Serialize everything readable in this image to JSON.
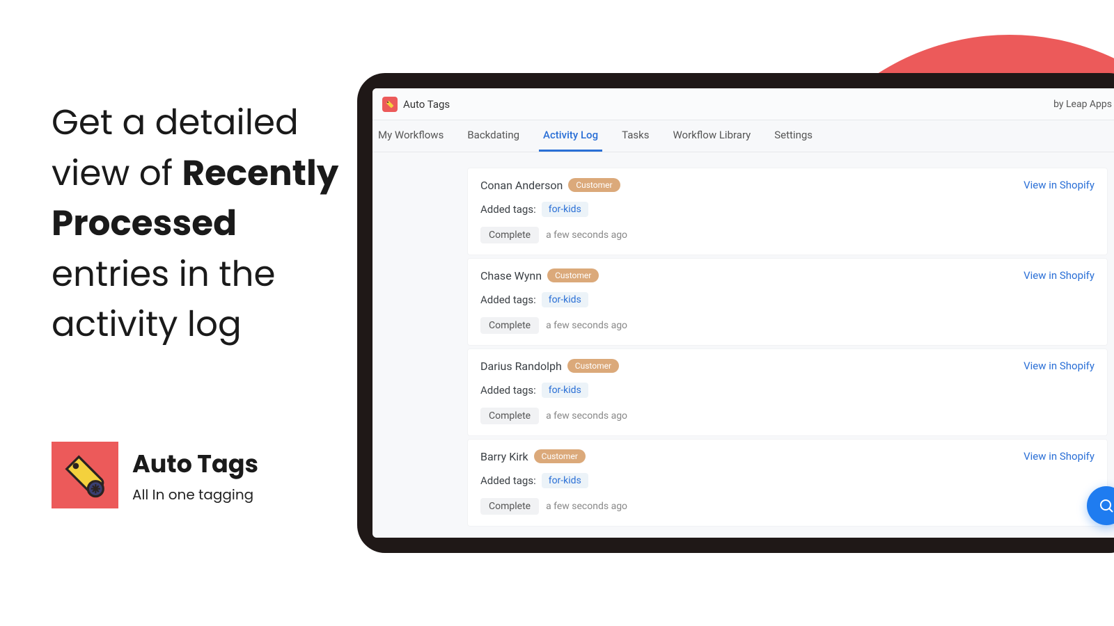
{
  "marketing": {
    "line1": "Get a detailed view of",
    "bold": "Recently Processed",
    "line2": "entries in the activity log"
  },
  "brand": {
    "name": "Auto Tags",
    "tagline": "All In one tagging"
  },
  "header": {
    "app_title": "Auto Tags",
    "by_text": "by Leap Apps"
  },
  "tabs": [
    {
      "label": "My Workflows",
      "active": false
    },
    {
      "label": "Backdating",
      "active": false
    },
    {
      "label": "Activity Log",
      "active": true
    },
    {
      "label": "Tasks",
      "active": false
    },
    {
      "label": "Workflow Library",
      "active": false
    },
    {
      "label": "Settings",
      "active": false
    }
  ],
  "labels": {
    "added_tags": "Added tags:",
    "view_link": "View in Shopify",
    "status_complete": "Complete",
    "time_few_seconds": "a few seconds ago",
    "badge_customer": "Customer"
  },
  "entries": [
    {
      "name": "Conan Anderson",
      "type": "Customer",
      "tags": [
        "for-kids"
      ],
      "status": "Complete",
      "time": "a few seconds ago"
    },
    {
      "name": "Chase Wynn",
      "type": "Customer",
      "tags": [
        "for-kids"
      ],
      "status": "Complete",
      "time": "a few seconds ago"
    },
    {
      "name": "Darius Randolph",
      "type": "Customer",
      "tags": [
        "for-kids"
      ],
      "status": "Complete",
      "time": "a few seconds ago"
    },
    {
      "name": "Barry Kirk",
      "type": "Customer",
      "tags": [
        "for-kids"
      ],
      "status": "Complete",
      "time": "a few seconds ago"
    }
  ]
}
